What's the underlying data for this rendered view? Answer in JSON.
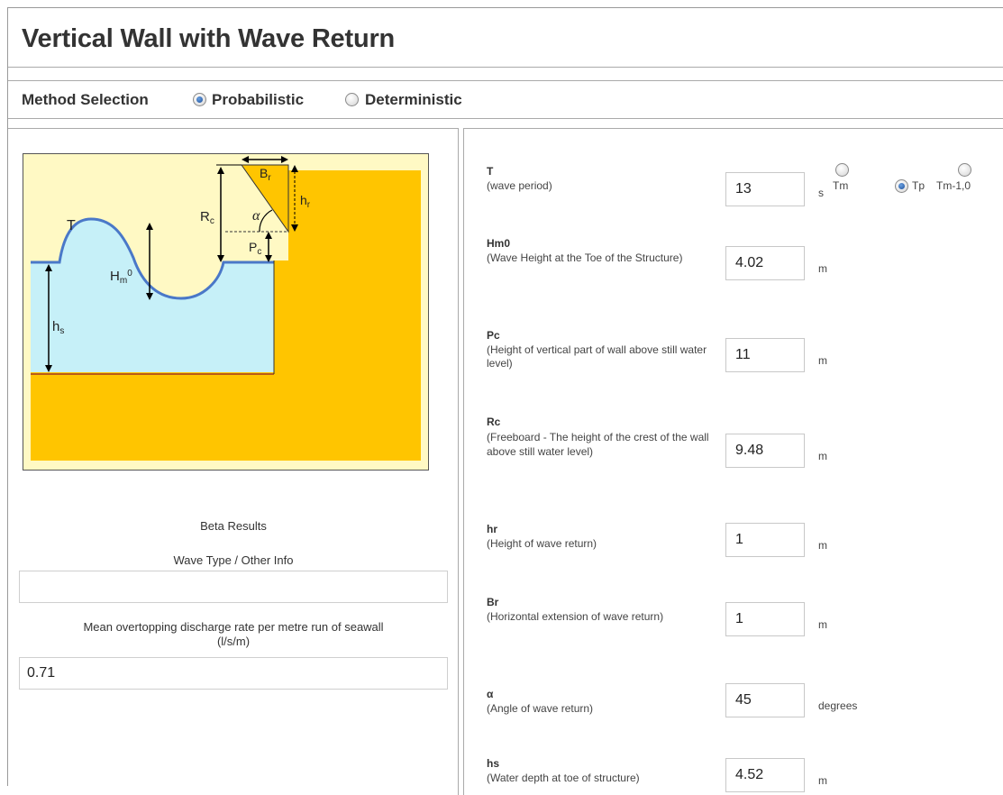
{
  "title": "Vertical Wall with Wave Return",
  "method": {
    "label": "Method Selection",
    "options": [
      {
        "label": "Probabilistic",
        "selected": true
      },
      {
        "label": "Deterministic",
        "selected": false
      }
    ]
  },
  "diagram": {
    "labels": {
      "T": "T",
      "Rc": "R",
      "Rc_sub": "c",
      "Pc": "P",
      "Pc_sub": "c",
      "Br": "B",
      "Br_sub": "r",
      "hr": "h",
      "hr_sub": "r",
      "alpha": "α",
      "Hm0": "H",
      "Hm0_sub": "m",
      "Hm0_sup": "0",
      "hs": "h",
      "hs_sub": "s"
    },
    "colors": {
      "background": "#fff9c4",
      "structure": "#ffc500",
      "water": "#c6f0f8",
      "wave_line": "#4a78c8",
      "seabed_line": "#b85c1a"
    }
  },
  "results": {
    "beta_label": "Beta Results",
    "wave_type_label": "Wave Type / Other Info",
    "wave_type_value": "",
    "discharge_label": "Mean overtopping discharge rate per metre run of seawall",
    "discharge_unit": "(l/s/m)",
    "discharge_value": "0.71"
  },
  "params": {
    "T": {
      "symbol": "T",
      "desc": "(wave period)",
      "value": "13",
      "unit": "s"
    },
    "period_options": [
      {
        "label": "Tm",
        "selected": false
      },
      {
        "label": "Tp",
        "selected": true
      },
      {
        "label": "Tm-1,0",
        "selected": false
      }
    ],
    "Hm0": {
      "symbol": "Hm0",
      "desc": "(Wave Height at the Toe of the Structure)",
      "value": "4.02",
      "unit": "m"
    },
    "Pc": {
      "symbol": "Pc",
      "desc": "(Height of vertical part of wall above still water level)",
      "value": "11",
      "unit": "m"
    },
    "Rc": {
      "symbol": "Rc",
      "desc": "(Freeboard - The height of the crest of the wall above still water level)",
      "value": "9.48",
      "unit": "m"
    },
    "hr": {
      "symbol": "hr",
      "desc": "(Height of wave return)",
      "value": "1",
      "unit": "m"
    },
    "Br": {
      "symbol": "Br",
      "desc": "(Horizontal extension of wave return)",
      "value": "1",
      "unit": "m"
    },
    "alpha": {
      "symbol": "α",
      "desc": "(Angle of wave return)",
      "value": "45",
      "unit": "degrees"
    },
    "hs": {
      "symbol": "hs",
      "desc": "(Water depth at toe of structure)",
      "value": "4.52",
      "unit": "m"
    }
  }
}
